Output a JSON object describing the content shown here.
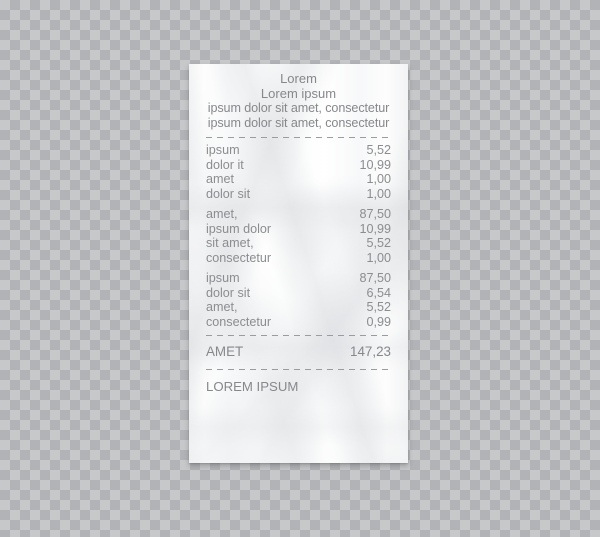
{
  "receipt": {
    "header": [
      {
        "text": "Lorem",
        "style": "narrow"
      },
      {
        "text": "Lorem ipsum",
        "style": "narrow"
      },
      {
        "text": "ipsum dolor sit amet, consectetur",
        "style": "wide"
      },
      {
        "text": "ipsum dolor sit amet, consectetur",
        "style": "wide"
      }
    ],
    "items_group_one": [
      {
        "label": "ipsum",
        "price": "5,52"
      },
      {
        "label": "dolor it",
        "price": "10,99"
      },
      {
        "label": "amet",
        "price": "1,00"
      },
      {
        "label": "dolor sit",
        "price": "1,00"
      }
    ],
    "items_group_two": [
      {
        "label": "amet,",
        "price": "87,50"
      },
      {
        "label": "ipsum dolor",
        "price": "10,99"
      },
      {
        "label": "sit amet,",
        "price": "5,52"
      },
      {
        "label": "consectetur",
        "price": "1,00"
      }
    ],
    "items_group_three": [
      {
        "label": "ipsum",
        "price": "87,50"
      },
      {
        "label": "dolor sit",
        "price": "6,54"
      },
      {
        "label": "amet,",
        "price": "5,52"
      },
      {
        "label": "consectetur",
        "price": "0,99"
      }
    ],
    "total": {
      "label": "AMET",
      "price": "147,23"
    },
    "footer": "LOREM IPSUM"
  },
  "colors": {
    "paper": "#fbfbfb",
    "text": "#8b8d90",
    "dash": "#9a9c9f",
    "checker_light": "#c6c8ca",
    "checker_dark": "#b1b3b6"
  }
}
